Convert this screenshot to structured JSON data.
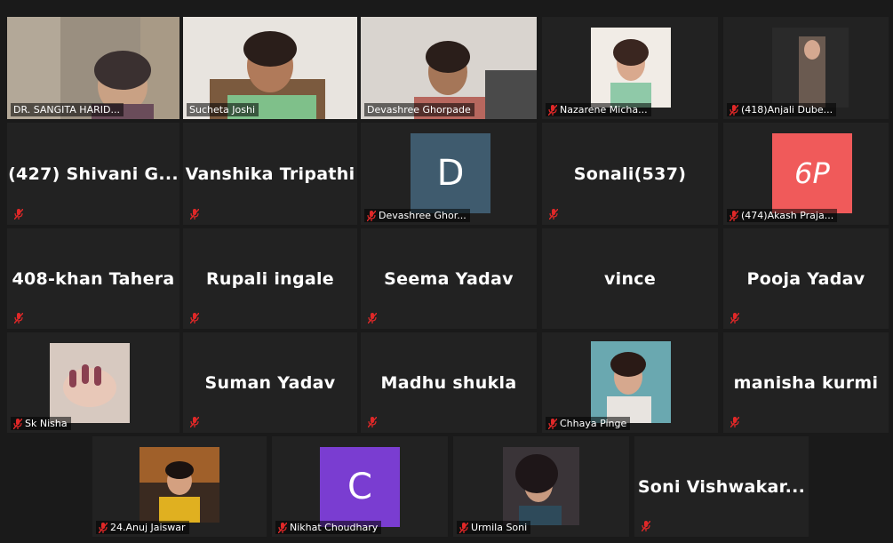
{
  "meeting": {
    "tiles": [
      {
        "name": "DR. SANGITA HARID..."
      },
      {
        "name": "Sucheta Joshi"
      },
      {
        "name": "Devashree Ghorpade"
      },
      {
        "name": "Nazarene Micha..."
      },
      {
        "name": "(418)Anjali Dube..."
      },
      {
        "name": "(427) Shivani G..."
      },
      {
        "name": "Vanshika Tripathi"
      },
      {
        "name": "Devashree Ghor...",
        "avatar_letter": "D"
      },
      {
        "name": "Sonali(537)"
      },
      {
        "name": "(474)Akash Praja...",
        "avatar_letter": "6P"
      },
      {
        "name": "408-khan Tahera"
      },
      {
        "name": "Rupali ingale"
      },
      {
        "name": "Seema Yadav"
      },
      {
        "name": "vince"
      },
      {
        "name": "Pooja Yadav"
      },
      {
        "name": "Sk Nisha"
      },
      {
        "name": "Suman Yadav"
      },
      {
        "name": "Madhu shukla"
      },
      {
        "name": "Chhaya Pinge"
      },
      {
        "name": "manisha kurmi"
      },
      {
        "name": "24.Anuj Jaiswar"
      },
      {
        "name": "Nikhat Choudhary",
        "avatar_letter": "C"
      },
      {
        "name": "Urmila Soni"
      },
      {
        "name": "Soni  Vishwakar..."
      }
    ]
  },
  "colors": {
    "active_speaker_border": "#b5d336",
    "muted_icon": "#e02828",
    "tile_background": "#222222",
    "avatar_D": "#3f5b6e",
    "avatar_6P": "#f05a5a",
    "avatar_C": "#7a3dd1"
  },
  "icons": {
    "muted": "microphone-muted-icon"
  }
}
